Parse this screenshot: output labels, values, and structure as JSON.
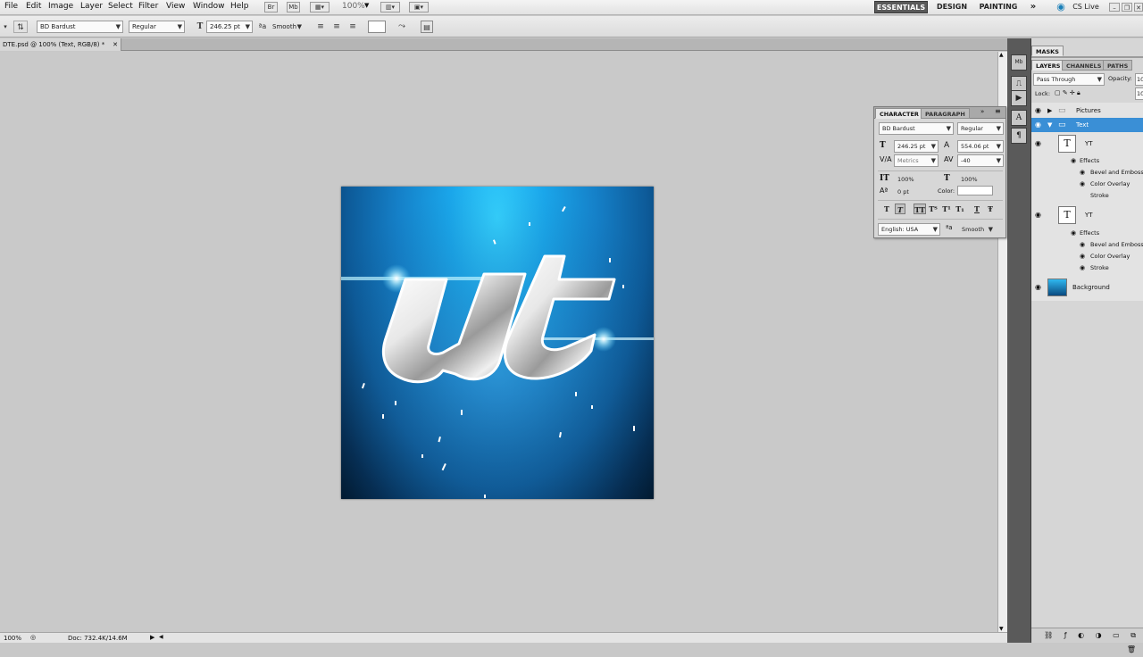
{
  "menu": {
    "items": [
      "File",
      "Edit",
      "Image",
      "Layer",
      "Select",
      "Filter",
      "View",
      "Window",
      "Help"
    ],
    "bridge": "Br",
    "minibridge": "Mb",
    "zoom": "100%"
  },
  "workspaces": {
    "essentials": "ESSENTIALS",
    "design": "DESIGN",
    "painting": "PAINTING",
    "more": "»",
    "cslive": "CS Live"
  },
  "options_bar": {
    "font_family": "BD Bardust",
    "font_style": "Regular",
    "font_size": "246.25 pt",
    "aa_symbol": "ªa",
    "antialias": "Smooth"
  },
  "document": {
    "tab_title": "DTE.psd @ 100% (Text, RGB/8) *"
  },
  "status": {
    "zoom": "100%",
    "doc": "Doc: 732.4K/14.6M"
  },
  "artwork": {
    "text": "ut"
  },
  "masks_panel": {
    "title": "MASKS"
  },
  "layers_panel": {
    "tabs": [
      "LAYERS",
      "CHANNELS",
      "PATHS"
    ],
    "blend_mode": "Pass Through",
    "opacity_label": "Opacity:",
    "opacity_value": "10",
    "lock_label": "Lock:",
    "fill_value": "10",
    "layers": [
      {
        "name": "Pictures"
      },
      {
        "name": "Text"
      },
      {
        "name": "YT"
      },
      {
        "name": "Effects"
      },
      {
        "name": "Bevel and Emboss"
      },
      {
        "name": "Color Overlay"
      },
      {
        "name": "Stroke"
      },
      {
        "name": "YT"
      },
      {
        "name": "Effects"
      },
      {
        "name": "Bevel and Emboss"
      },
      {
        "name": "Color Overlay"
      },
      {
        "name": "Stroke"
      },
      {
        "name": "Background"
      }
    ]
  },
  "character_panel": {
    "tabs": [
      "CHARACTER",
      "PARAGRAPH"
    ],
    "font_family": "BD Bardust",
    "font_style": "Regular",
    "size": "246.25 pt",
    "leading": "554.06 pt",
    "kerning": "Metrics",
    "tracking": "-40",
    "vscale": "100%",
    "hscale": "100%",
    "baseline": "0 pt",
    "color_label": "Color:",
    "language": "English: USA",
    "antialias": "Smooth",
    "style_buttons": [
      "T",
      "T",
      "TT",
      "Tᵀ",
      "T¹",
      "T₁",
      "T",
      "Ŧ"
    ]
  }
}
